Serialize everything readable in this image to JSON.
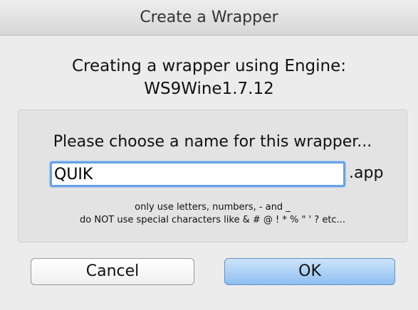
{
  "window": {
    "title": "Create a Wrapper"
  },
  "header": {
    "line1": "Creating a wrapper using Engine:",
    "line2": "WS9Wine1.7.12"
  },
  "form": {
    "prompt": "Please choose a name for this wrapper...",
    "name_value": "QUIK",
    "suffix": ".app",
    "hint_line1": "only use letters, numbers, - and _",
    "hint_line2": "do NOT use special characters like & # @ ! * % \" ' ? etc..."
  },
  "buttons": {
    "cancel_label": "Cancel",
    "ok_label": "OK"
  },
  "colors": {
    "focus_ring": "#6aa3e6",
    "default_button": "#8fbef0",
    "window_bg": "#ececec"
  }
}
